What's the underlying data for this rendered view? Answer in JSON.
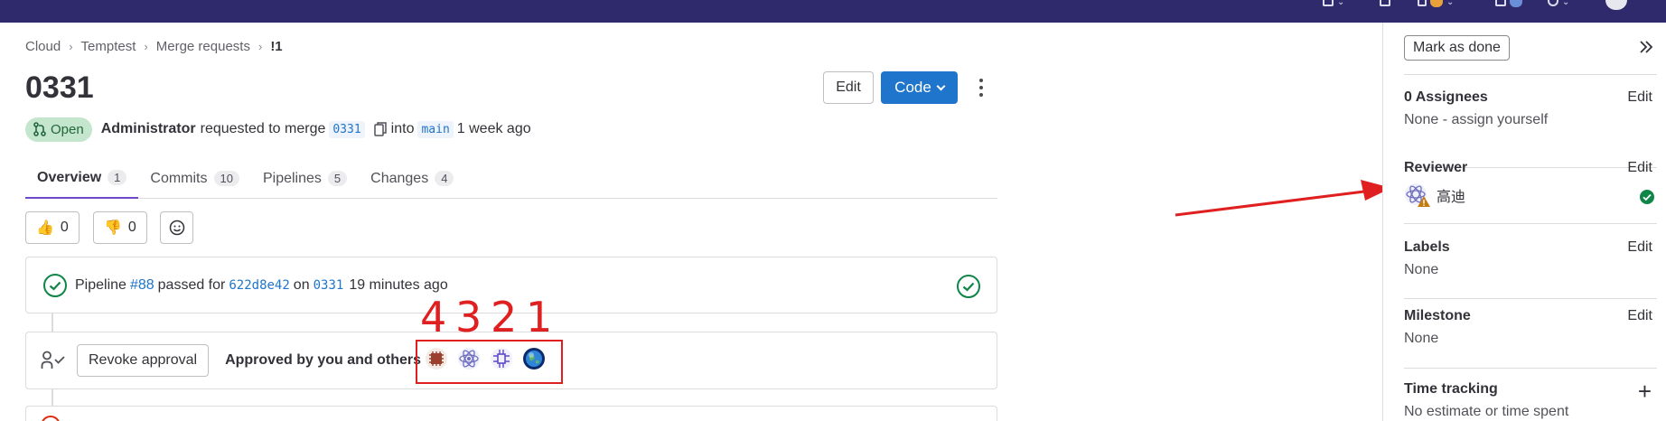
{
  "breadcrumb": {
    "items": [
      "Cloud",
      "Temptest",
      "Merge requests"
    ],
    "current": "!1"
  },
  "mr": {
    "title": "0331",
    "status": "Open",
    "author": "Administrator",
    "requested_text": "requested to merge",
    "source_branch": "0331",
    "into_text": "into",
    "target_branch": "main",
    "time": "1 week ago"
  },
  "actions": {
    "edit": "Edit",
    "code": "Code"
  },
  "tabs": [
    {
      "label": "Overview",
      "count": "1"
    },
    {
      "label": "Commits",
      "count": "10"
    },
    {
      "label": "Pipelines",
      "count": "5"
    },
    {
      "label": "Changes",
      "count": "4"
    }
  ],
  "reactions": {
    "thumbs_up": "0",
    "thumbs_down": "0"
  },
  "pipeline": {
    "prefix": "Pipeline",
    "id": "#88",
    "passed_for": "passed for",
    "commit": "622d8e42",
    "on": "on",
    "branch": "0331",
    "time": "19 minutes ago"
  },
  "approval": {
    "revoke": "Revoke approval",
    "text": "Approved by you and others",
    "approver_icons": [
      "avatar-brown-pattern-icon",
      "avatar-atom-icon",
      "avatar-purple-pattern-icon",
      "avatar-earth-icon"
    ]
  },
  "annotation": {
    "numbers": [
      "4",
      "3",
      "2",
      "1"
    ],
    "color": "#e02020"
  },
  "sidebar": {
    "mark_done": "Mark as done",
    "assignees": {
      "title": "0 Assignees",
      "edit": "Edit",
      "value": "None - assign yourself"
    },
    "reviewer": {
      "title": "Reviewer",
      "edit": "Edit",
      "name": "高迪"
    },
    "labels": {
      "title": "Labels",
      "edit": "Edit",
      "value": "None"
    },
    "milestone": {
      "title": "Milestone",
      "edit": "Edit",
      "value": "None"
    },
    "time_tracking": {
      "title": "Time tracking",
      "value": "No estimate or time spent"
    }
  },
  "colors": {
    "topbar": "#2f2a6b",
    "primary": "#1f75cb",
    "success": "#108548",
    "tab_active": "#6e49cb",
    "annotation": "#e02020"
  }
}
